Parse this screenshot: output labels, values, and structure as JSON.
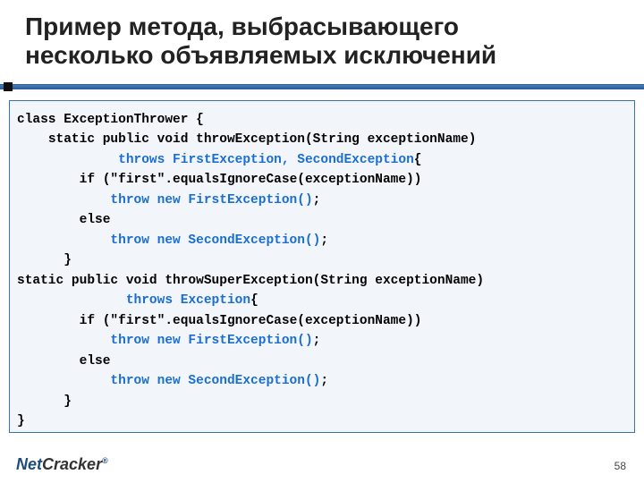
{
  "title_line1": "Пример метода, выбрасывающего",
  "title_line2": "несколько объявляемых исключений",
  "code": {
    "l1": "class ExceptionThrower {",
    "l2": "    static public void throwException(String exceptionName)",
    "l3a": "             ",
    "l3b": "throws FirstException, SecondException",
    "l3c": "{",
    "l4": "        if (\"first\".equalsIgnoreCase(exceptionName))",
    "l5a": "            ",
    "l5b": "throw new FirstException()",
    "l5c": ";",
    "l6": "        else",
    "l7a": "            ",
    "l7b": "throw new SecondException()",
    "l7c": ";",
    "l8": "      }",
    "l9": "static public void throwSuperException(String exceptionName)",
    "l10a": "              ",
    "l10b": "throws Exception",
    "l10c": "{",
    "l11": "        if (\"first\".equalsIgnoreCase(exceptionName))",
    "l12a": "            ",
    "l12b": "throw new FirstException()",
    "l12c": ";",
    "l13": "        else",
    "l14a": "            ",
    "l14b": "throw new SecondException()",
    "l14c": ";",
    "l15": "      }",
    "l16": "}"
  },
  "logo_net": "Net",
  "logo_cracker": "Cracker",
  "logo_reg": "®",
  "page_number": "58"
}
